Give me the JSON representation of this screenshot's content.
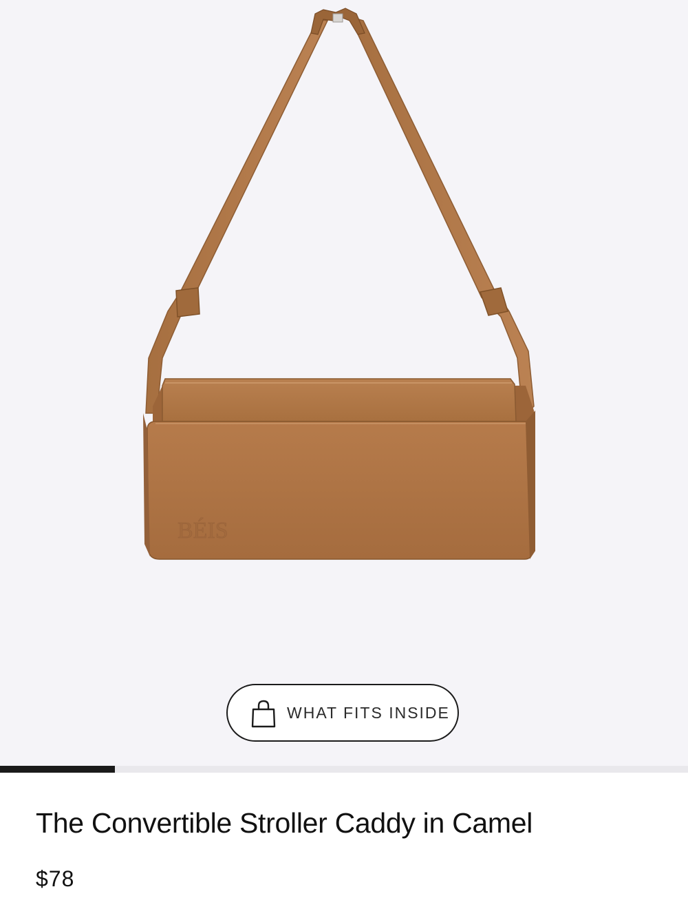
{
  "gallery": {
    "image_alt": "Camel leather shoulder bag with strap",
    "brand_emboss": "BÉIS",
    "progress": 0.167
  },
  "fits_button": {
    "icon": "shopping-bag-icon",
    "label": "WHAT FITS INSIDE"
  },
  "product": {
    "title": "The Convertible Stroller Caddy in Camel",
    "price": "$78"
  },
  "colors": {
    "background": "#f5f4f8",
    "bag_camel": "#b07647",
    "text": "#111111"
  }
}
